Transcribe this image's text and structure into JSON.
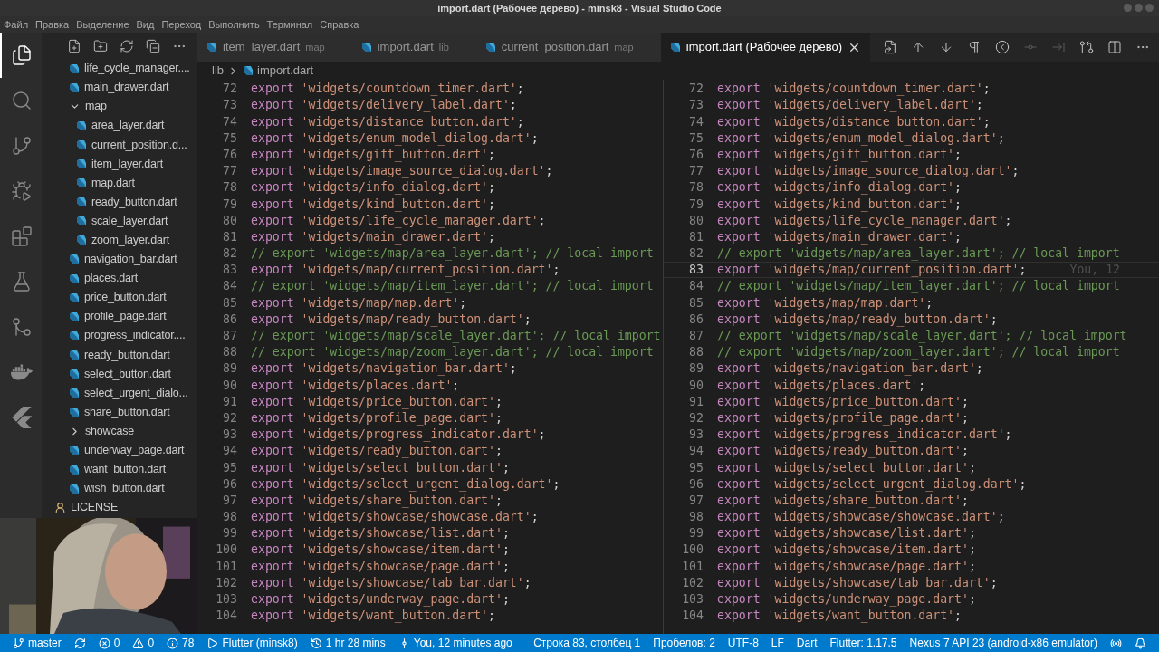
{
  "window": {
    "title": "import.dart (Рабочее дерево) - minsk8 - Visual Studio Code"
  },
  "menu": [
    "Файл",
    "Правка",
    "Выделение",
    "Вид",
    "Переход",
    "Выполнить",
    "Терминал",
    "Справка"
  ],
  "activity_bar": [
    {
      "kind": "files",
      "selected": true
    },
    {
      "kind": "search",
      "selected": false
    },
    {
      "kind": "source-control",
      "selected": false
    },
    {
      "kind": "run",
      "selected": false
    },
    {
      "kind": "extensions",
      "selected": false
    },
    {
      "kind": "testing",
      "selected": false
    },
    {
      "kind": "git-graph",
      "selected": false
    },
    {
      "kind": "docker",
      "selected": false
    },
    {
      "kind": "flutter",
      "selected": false
    }
  ],
  "sidebar": {
    "items": [
      {
        "label": "life_cycle_manager....",
        "kind": "dart"
      },
      {
        "label": "main_drawer.dart",
        "kind": "dart"
      },
      {
        "label": "map",
        "kind": "folder",
        "expanded": true,
        "children": [
          {
            "label": "area_layer.dart",
            "kind": "dart"
          },
          {
            "label": "current_position.d...",
            "kind": "dart"
          },
          {
            "label": "item_layer.dart",
            "kind": "dart"
          },
          {
            "label": "map.dart",
            "kind": "dart"
          },
          {
            "label": "ready_button.dart",
            "kind": "dart"
          },
          {
            "label": "scale_layer.dart",
            "kind": "dart"
          },
          {
            "label": "zoom_layer.dart",
            "kind": "dart"
          }
        ]
      },
      {
        "label": "navigation_bar.dart",
        "kind": "dart"
      },
      {
        "label": "places.dart",
        "kind": "dart"
      },
      {
        "label": "price_button.dart",
        "kind": "dart"
      },
      {
        "label": "profile_page.dart",
        "kind": "dart"
      },
      {
        "label": "progress_indicator....",
        "kind": "dart"
      },
      {
        "label": "ready_button.dart",
        "kind": "dart"
      },
      {
        "label": "select_button.dart",
        "kind": "dart"
      },
      {
        "label": "select_urgent_dialo...",
        "kind": "dart"
      },
      {
        "label": "share_button.dart",
        "kind": "dart"
      },
      {
        "label": "showcase",
        "kind": "folder",
        "expanded": false
      },
      {
        "label": "underway_page.dart",
        "kind": "dart"
      },
      {
        "label": "want_button.dart",
        "kind": "dart"
      },
      {
        "label": "wish_button.dart",
        "kind": "dart"
      }
    ],
    "parent_level_items": [
      {
        "label": "LICENSE",
        "kind": "license"
      }
    ]
  },
  "tabs": [
    {
      "label": "item_layer.dart",
      "hint": "map",
      "selected": false
    },
    {
      "label": "import.dart",
      "hint": "lib",
      "selected": false
    },
    {
      "label": "current_position.dart",
      "hint": "map",
      "selected": false
    },
    {
      "label": "import.dart (Рабочее дерево)",
      "selected": true
    }
  ],
  "editor_toolbar": [
    {
      "kind": "open-file",
      "disabled": false
    },
    {
      "kind": "up",
      "disabled": false
    },
    {
      "kind": "down",
      "disabled": false
    },
    {
      "kind": "pilcrow",
      "disabled": false
    },
    {
      "kind": "revert",
      "disabled": false
    },
    {
      "kind": "stage",
      "disabled": true
    },
    {
      "kind": "next",
      "disabled": true
    },
    {
      "kind": "compare",
      "disabled": false
    },
    {
      "kind": "split",
      "disabled": false
    },
    {
      "kind": "more",
      "disabled": false
    }
  ],
  "breadcrumb": [
    "lib",
    "import.dart"
  ],
  "panes": [
    {
      "lines": [
        {
          "number": "72",
          "kind": "code",
          "text": "export 'widgets/countdown_timer.dart';"
        },
        {
          "number": "73",
          "kind": "code",
          "text": "export 'widgets/delivery_label.dart';"
        },
        {
          "number": "74",
          "kind": "code",
          "text": "export 'widgets/distance_button.dart';"
        },
        {
          "number": "75",
          "kind": "code",
          "text": "export 'widgets/enum_model_dialog.dart';"
        },
        {
          "number": "76",
          "kind": "code",
          "text": "export 'widgets/gift_button.dart';"
        },
        {
          "number": "77",
          "kind": "code",
          "text": "export 'widgets/image_source_dialog.dart';"
        },
        {
          "number": "78",
          "kind": "code",
          "text": "export 'widgets/info_dialog.dart';"
        },
        {
          "number": "79",
          "kind": "code",
          "text": "export 'widgets/kind_button.dart';"
        },
        {
          "number": "80",
          "kind": "code",
          "text": "export 'widgets/life_cycle_manager.dart';"
        },
        {
          "number": "81",
          "kind": "code",
          "text": "export 'widgets/main_drawer.dart';"
        },
        {
          "number": "82",
          "kind": "comment",
          "text": "// export 'widgets/map/area_layer.dart'; // local import"
        },
        {
          "number": "83",
          "kind": "code",
          "text": "export 'widgets/map/current_position.dart';"
        },
        {
          "number": "84",
          "kind": "comment",
          "text": "// export 'widgets/map/item_layer.dart'; // local import"
        },
        {
          "number": "85",
          "kind": "code",
          "text": "export 'widgets/map/map.dart';"
        },
        {
          "number": "86",
          "kind": "code",
          "text": "export 'widgets/map/ready_button.dart';"
        },
        {
          "number": "87",
          "kind": "comment",
          "text": "// export 'widgets/map/scale_layer.dart'; // local import"
        },
        {
          "number": "88",
          "kind": "comment",
          "text": "// export 'widgets/map/zoom_layer.dart'; // local import"
        },
        {
          "number": "89",
          "kind": "code",
          "text": "export 'widgets/navigation_bar.dart';"
        },
        {
          "number": "90",
          "kind": "code",
          "text": "export 'widgets/places.dart';"
        },
        {
          "number": "91",
          "kind": "code",
          "text": "export 'widgets/price_button.dart';"
        },
        {
          "number": "92",
          "kind": "code",
          "text": "export 'widgets/profile_page.dart';"
        },
        {
          "number": "93",
          "kind": "code",
          "text": "export 'widgets/progress_indicator.dart';"
        },
        {
          "number": "94",
          "kind": "code",
          "text": "export 'widgets/ready_button.dart';"
        },
        {
          "number": "95",
          "kind": "code",
          "text": "export 'widgets/select_button.dart';"
        },
        {
          "number": "96",
          "kind": "code",
          "text": "export 'widgets/select_urgent_dialog.dart';"
        },
        {
          "number": "97",
          "kind": "code",
          "text": "export 'widgets/share_button.dart';"
        },
        {
          "number": "98",
          "kind": "code",
          "text": "export 'widgets/showcase/showcase.dart';"
        },
        {
          "number": "99",
          "kind": "code",
          "text": "export 'widgets/showcase/list.dart';"
        },
        {
          "number": "100",
          "kind": "code",
          "text": "export 'widgets/showcase/item.dart';"
        },
        {
          "number": "101",
          "kind": "code",
          "text": "export 'widgets/showcase/page.dart';"
        },
        {
          "number": "102",
          "kind": "code",
          "text": "export 'widgets/showcase/tab_bar.dart';"
        },
        {
          "number": "103",
          "kind": "code",
          "text": "export 'widgets/underway_page.dart';"
        },
        {
          "number": "104",
          "kind": "code",
          "text": "export 'widgets/want_button.dart';"
        }
      ]
    },
    {
      "lines": [
        {
          "number": "72",
          "kind": "code",
          "text": "export 'widgets/countdown_timer.dart';"
        },
        {
          "number": "73",
          "kind": "code",
          "text": "export 'widgets/delivery_label.dart';"
        },
        {
          "number": "74",
          "kind": "code",
          "text": "export 'widgets/distance_button.dart';"
        },
        {
          "number": "75",
          "kind": "code",
          "text": "export 'widgets/enum_model_dialog.dart';"
        },
        {
          "number": "76",
          "kind": "code",
          "text": "export 'widgets/gift_button.dart';"
        },
        {
          "number": "77",
          "kind": "code",
          "text": "export 'widgets/image_source_dialog.dart';"
        },
        {
          "number": "78",
          "kind": "code",
          "text": "export 'widgets/info_dialog.dart';"
        },
        {
          "number": "79",
          "kind": "code",
          "text": "export 'widgets/kind_button.dart';"
        },
        {
          "number": "80",
          "kind": "code",
          "text": "export 'widgets/life_cycle_manager.dart';"
        },
        {
          "number": "81",
          "kind": "code",
          "text": "export 'widgets/main_drawer.dart';"
        },
        {
          "number": "82",
          "kind": "comment",
          "text": "// export 'widgets/map/area_layer.dart'; // local import"
        },
        {
          "number": "83",
          "kind": "code",
          "text": "export 'widgets/map/current_position.dart';",
          "blame": "You, 12"
        },
        {
          "number": "84",
          "kind": "comment",
          "text": "// export 'widgets/map/item_layer.dart'; // local import"
        },
        {
          "number": "85",
          "kind": "code",
          "text": "export 'widgets/map/map.dart';"
        },
        {
          "number": "86",
          "kind": "code",
          "text": "export 'widgets/map/ready_button.dart';"
        },
        {
          "number": "87",
          "kind": "comment",
          "text": "// export 'widgets/map/scale_layer.dart'; // local import"
        },
        {
          "number": "88",
          "kind": "comment",
          "text": "// export 'widgets/map/zoom_layer.dart'; // local import"
        },
        {
          "number": "89",
          "kind": "code",
          "text": "export 'widgets/navigation_bar.dart';"
        },
        {
          "number": "90",
          "kind": "code",
          "text": "export 'widgets/places.dart';"
        },
        {
          "number": "91",
          "kind": "code",
          "text": "export 'widgets/price_button.dart';"
        },
        {
          "number": "92",
          "kind": "code",
          "text": "export 'widgets/profile_page.dart';"
        },
        {
          "number": "93",
          "kind": "code",
          "text": "export 'widgets/progress_indicator.dart';"
        },
        {
          "number": "94",
          "kind": "code",
          "text": "export 'widgets/ready_button.dart';"
        },
        {
          "number": "95",
          "kind": "code",
          "text": "export 'widgets/select_button.dart';"
        },
        {
          "number": "96",
          "kind": "code",
          "text": "export 'widgets/select_urgent_dialog.dart';"
        },
        {
          "number": "97",
          "kind": "code",
          "text": "export 'widgets/share_button.dart';"
        },
        {
          "number": "98",
          "kind": "code",
          "text": "export 'widgets/showcase/showcase.dart';"
        },
        {
          "number": "99",
          "kind": "code",
          "text": "export 'widgets/showcase/list.dart';"
        },
        {
          "number": "100",
          "kind": "code",
          "text": "export 'widgets/showcase/item.dart';"
        },
        {
          "number": "101",
          "kind": "code",
          "text": "export 'widgets/showcase/page.dart';"
        },
        {
          "number": "102",
          "kind": "code",
          "text": "export 'widgets/showcase/tab_bar.dart';"
        },
        {
          "number": "103",
          "kind": "code",
          "text": "export 'widgets/underway_page.dart';"
        },
        {
          "number": "104",
          "kind": "code",
          "text": "export 'widgets/want_button.dart';"
        }
      ]
    }
  ],
  "webcam": {
    "kind": "picture"
  },
  "status_bar": {
    "left": [
      {
        "kind": "branch",
        "text": "master"
      },
      {
        "kind": "sync"
      },
      {
        "kind": "error",
        "text": "0"
      },
      {
        "kind": "warning",
        "text": "0"
      },
      {
        "kind": "info",
        "text": "78"
      },
      {
        "kind": "play",
        "text": "Flutter (minsk8)"
      },
      {
        "kind": "history",
        "text": "1 hr 28 mins"
      },
      {
        "kind": "commit",
        "text": "You, 12 minutes ago"
      }
    ],
    "right": [
      {
        "kind": "text",
        "text": "Строка 83, столбец 1"
      },
      {
        "kind": "text",
        "text": "Пробелов: 2"
      },
      {
        "kind": "text",
        "text": "UTF-8"
      },
      {
        "kind": "text",
        "text": "LF"
      },
      {
        "kind": "text",
        "text": "Dart"
      },
      {
        "kind": "text",
        "text": "Flutter: 1.17.5"
      },
      {
        "kind": "text",
        "text": "Nexus 7 API 23 (android-x86 emulator)"
      },
      {
        "kind": "broadcast"
      },
      {
        "kind": "bell"
      }
    ]
  }
}
